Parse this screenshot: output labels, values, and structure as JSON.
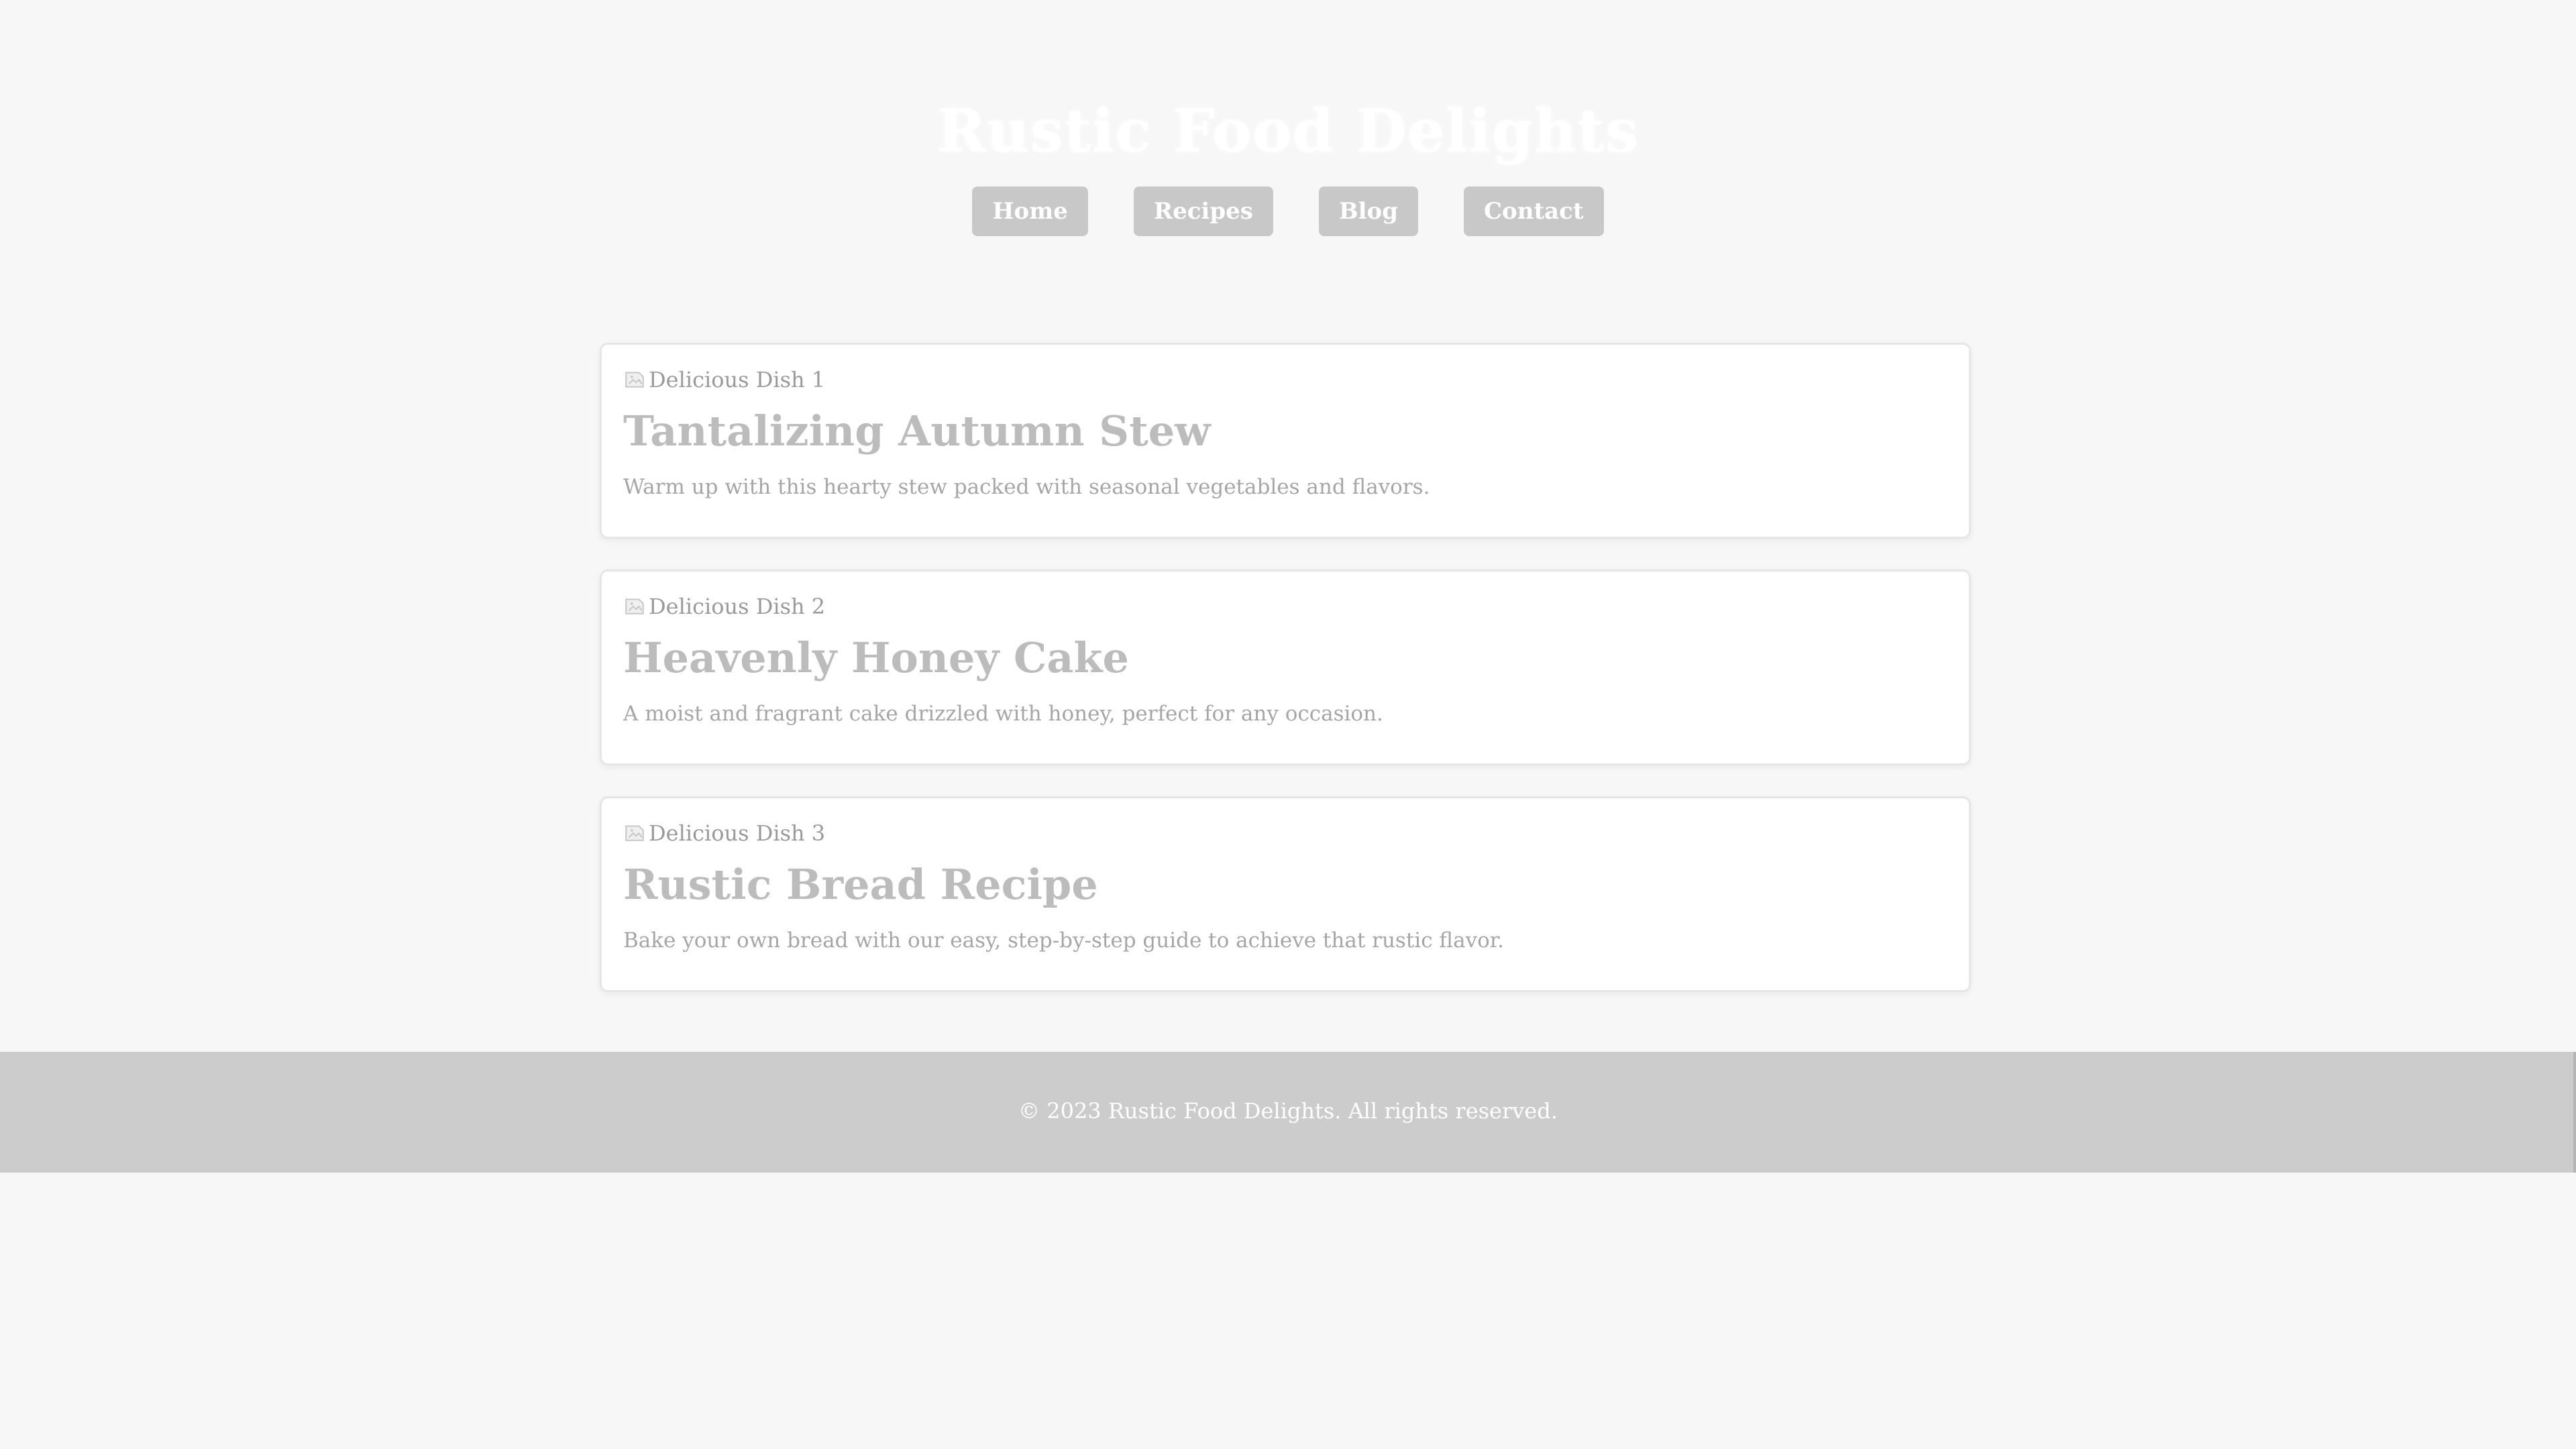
{
  "header": {
    "title": "Rustic Food Delights"
  },
  "nav": {
    "items": [
      {
        "label": "Home"
      },
      {
        "label": "Recipes"
      },
      {
        "label": "Blog"
      },
      {
        "label": "Contact"
      }
    ]
  },
  "cards": [
    {
      "image_alt": "Delicious Dish 1",
      "title": "Tantalizing Autumn Stew",
      "description": "Warm up with this hearty stew packed with seasonal vegetables and flavors."
    },
    {
      "image_alt": "Delicious Dish 2",
      "title": "Heavenly Honey Cake",
      "description": "A moist and fragrant cake drizzled with honey, perfect for any occasion."
    },
    {
      "image_alt": "Delicious Dish 3",
      "title": "Rustic Bread Recipe",
      "description": "Bake your own bread with our easy, step-by-step guide to achieve that rustic flavor."
    }
  ],
  "footer": {
    "text": "© 2023 Rustic Food Delights. All rights reserved."
  },
  "colors": {
    "background": "#f7f7f7",
    "nav_button": "#c8c8c8",
    "footer": "#cccccc",
    "card": "#ffffff"
  }
}
